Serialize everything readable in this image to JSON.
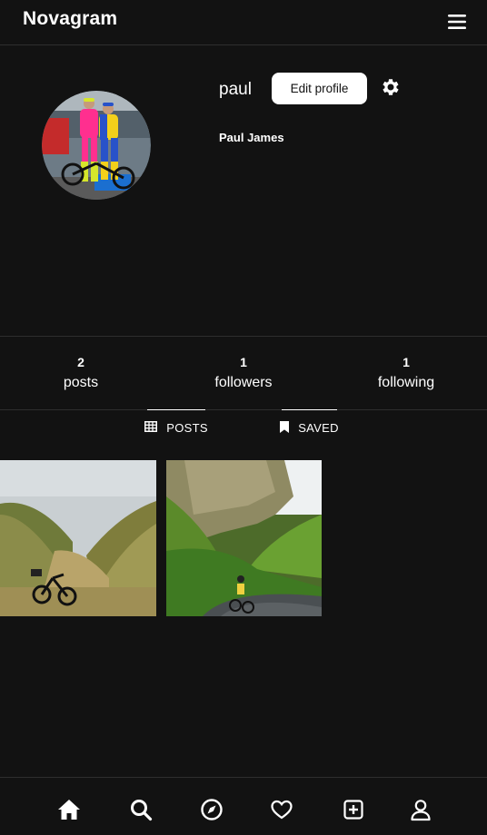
{
  "app": {
    "brand": "Novagram"
  },
  "profile": {
    "username": "paul",
    "full_name": "Paul James",
    "edit_label": "Edit profile"
  },
  "stats": [
    {
      "value": "2",
      "label": "posts"
    },
    {
      "value": "1",
      "label": "followers"
    },
    {
      "value": "1",
      "label": "following"
    }
  ],
  "tabs": [
    {
      "label": "POSTS",
      "icon": "grid-icon"
    },
    {
      "label": "SAVED",
      "icon": "bookmark-icon"
    }
  ],
  "posts": [
    {
      "icon": "photo-bike-valley"
    },
    {
      "icon": "photo-cyclist-road"
    }
  ],
  "bottom_nav": [
    "home-icon",
    "search-icon",
    "explore-icon",
    "heart-icon",
    "add-post-icon",
    "profile-icon"
  ],
  "colors": {
    "background": "#121212",
    "text": "#ffffff",
    "divider": "#2e2e2e",
    "button_bg": "#ffffff"
  }
}
